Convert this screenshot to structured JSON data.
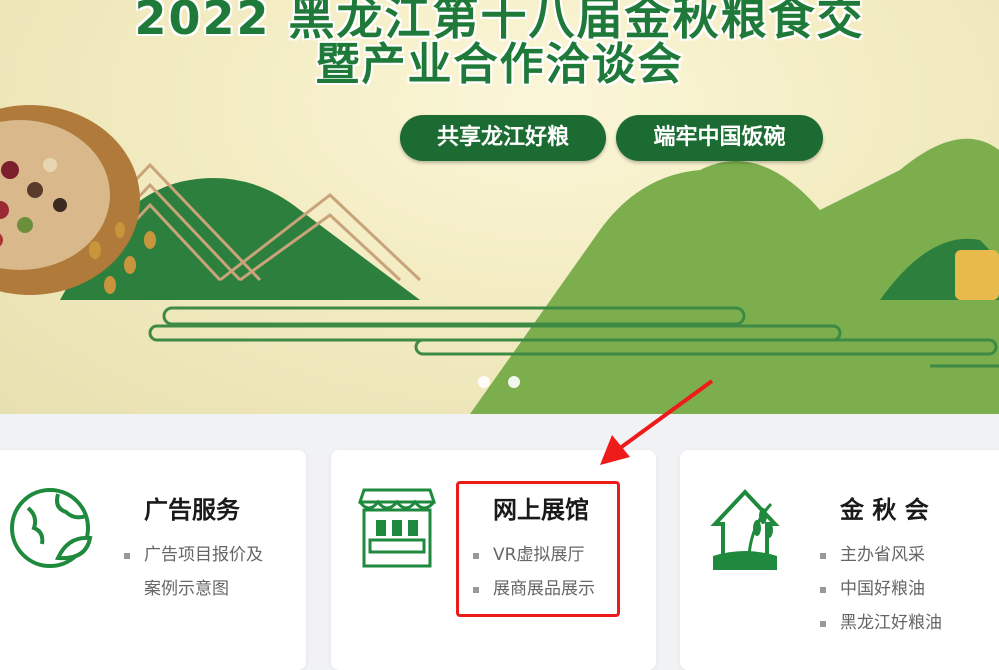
{
  "banner": {
    "title_line1": "2022 黑龙江第十八届金秋粮食交",
    "title_line2": "暨产业合作洽谈会",
    "slogan1": "共享龙江好粮",
    "slogan2": "端牢中国饭碗",
    "carousel_count": 2
  },
  "cards": [
    {
      "title": "广告服务",
      "icon": "globe-leaf-icon",
      "items": [
        "广告项目报价及",
        "案例示意图"
      ]
    },
    {
      "title": "网上展馆",
      "icon": "market-stall-icon",
      "items": [
        "VR虚拟展厅",
        "展商展品展示"
      ]
    },
    {
      "title": "金 秋 会",
      "icon": "wheat-house-icon",
      "items": [
        "主办省风采",
        "中国好粮油",
        "黑龙江好粮油"
      ]
    }
  ],
  "colors": {
    "brand_green": "#1c6b32",
    "annotation_red": "#ee1b1b"
  }
}
